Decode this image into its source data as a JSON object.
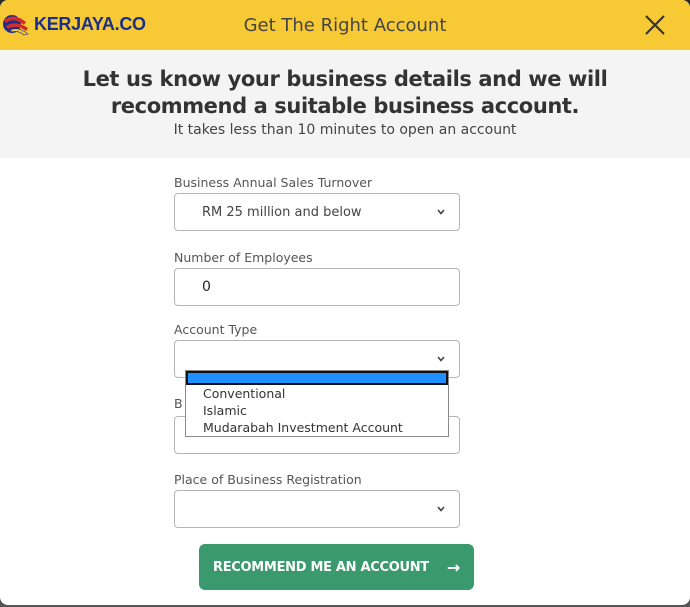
{
  "header": {
    "logo_text": "KERJAYA.CO",
    "title": "Get The Right Account"
  },
  "intro": {
    "heading": "Let us know your business details and we will recommend a suitable business account.",
    "subheading": "It takes less than 10 minutes to open an account"
  },
  "form": {
    "turnover": {
      "label": "Business Annual Sales Turnover",
      "value": "RM 25 million and below"
    },
    "employees": {
      "label": "Number of Employees",
      "value": "0"
    },
    "account_type": {
      "label": "Account Type",
      "value": "",
      "options": [
        "Conventional",
        "Islamic",
        "Mudarabah Investment Account"
      ]
    },
    "business_field": {
      "label_fragment": "B"
    },
    "registration": {
      "label": "Place of Business Registration",
      "value": ""
    },
    "submit_label": "RECOMMEND ME AN ACCOUNT",
    "submit_arrow": "→"
  },
  "colors": {
    "header_bg": "#f7c934",
    "submit_bg": "#3a9a6e",
    "logo_blue": "#1a2f8a",
    "dropdown_highlight": "#1e90ff"
  }
}
